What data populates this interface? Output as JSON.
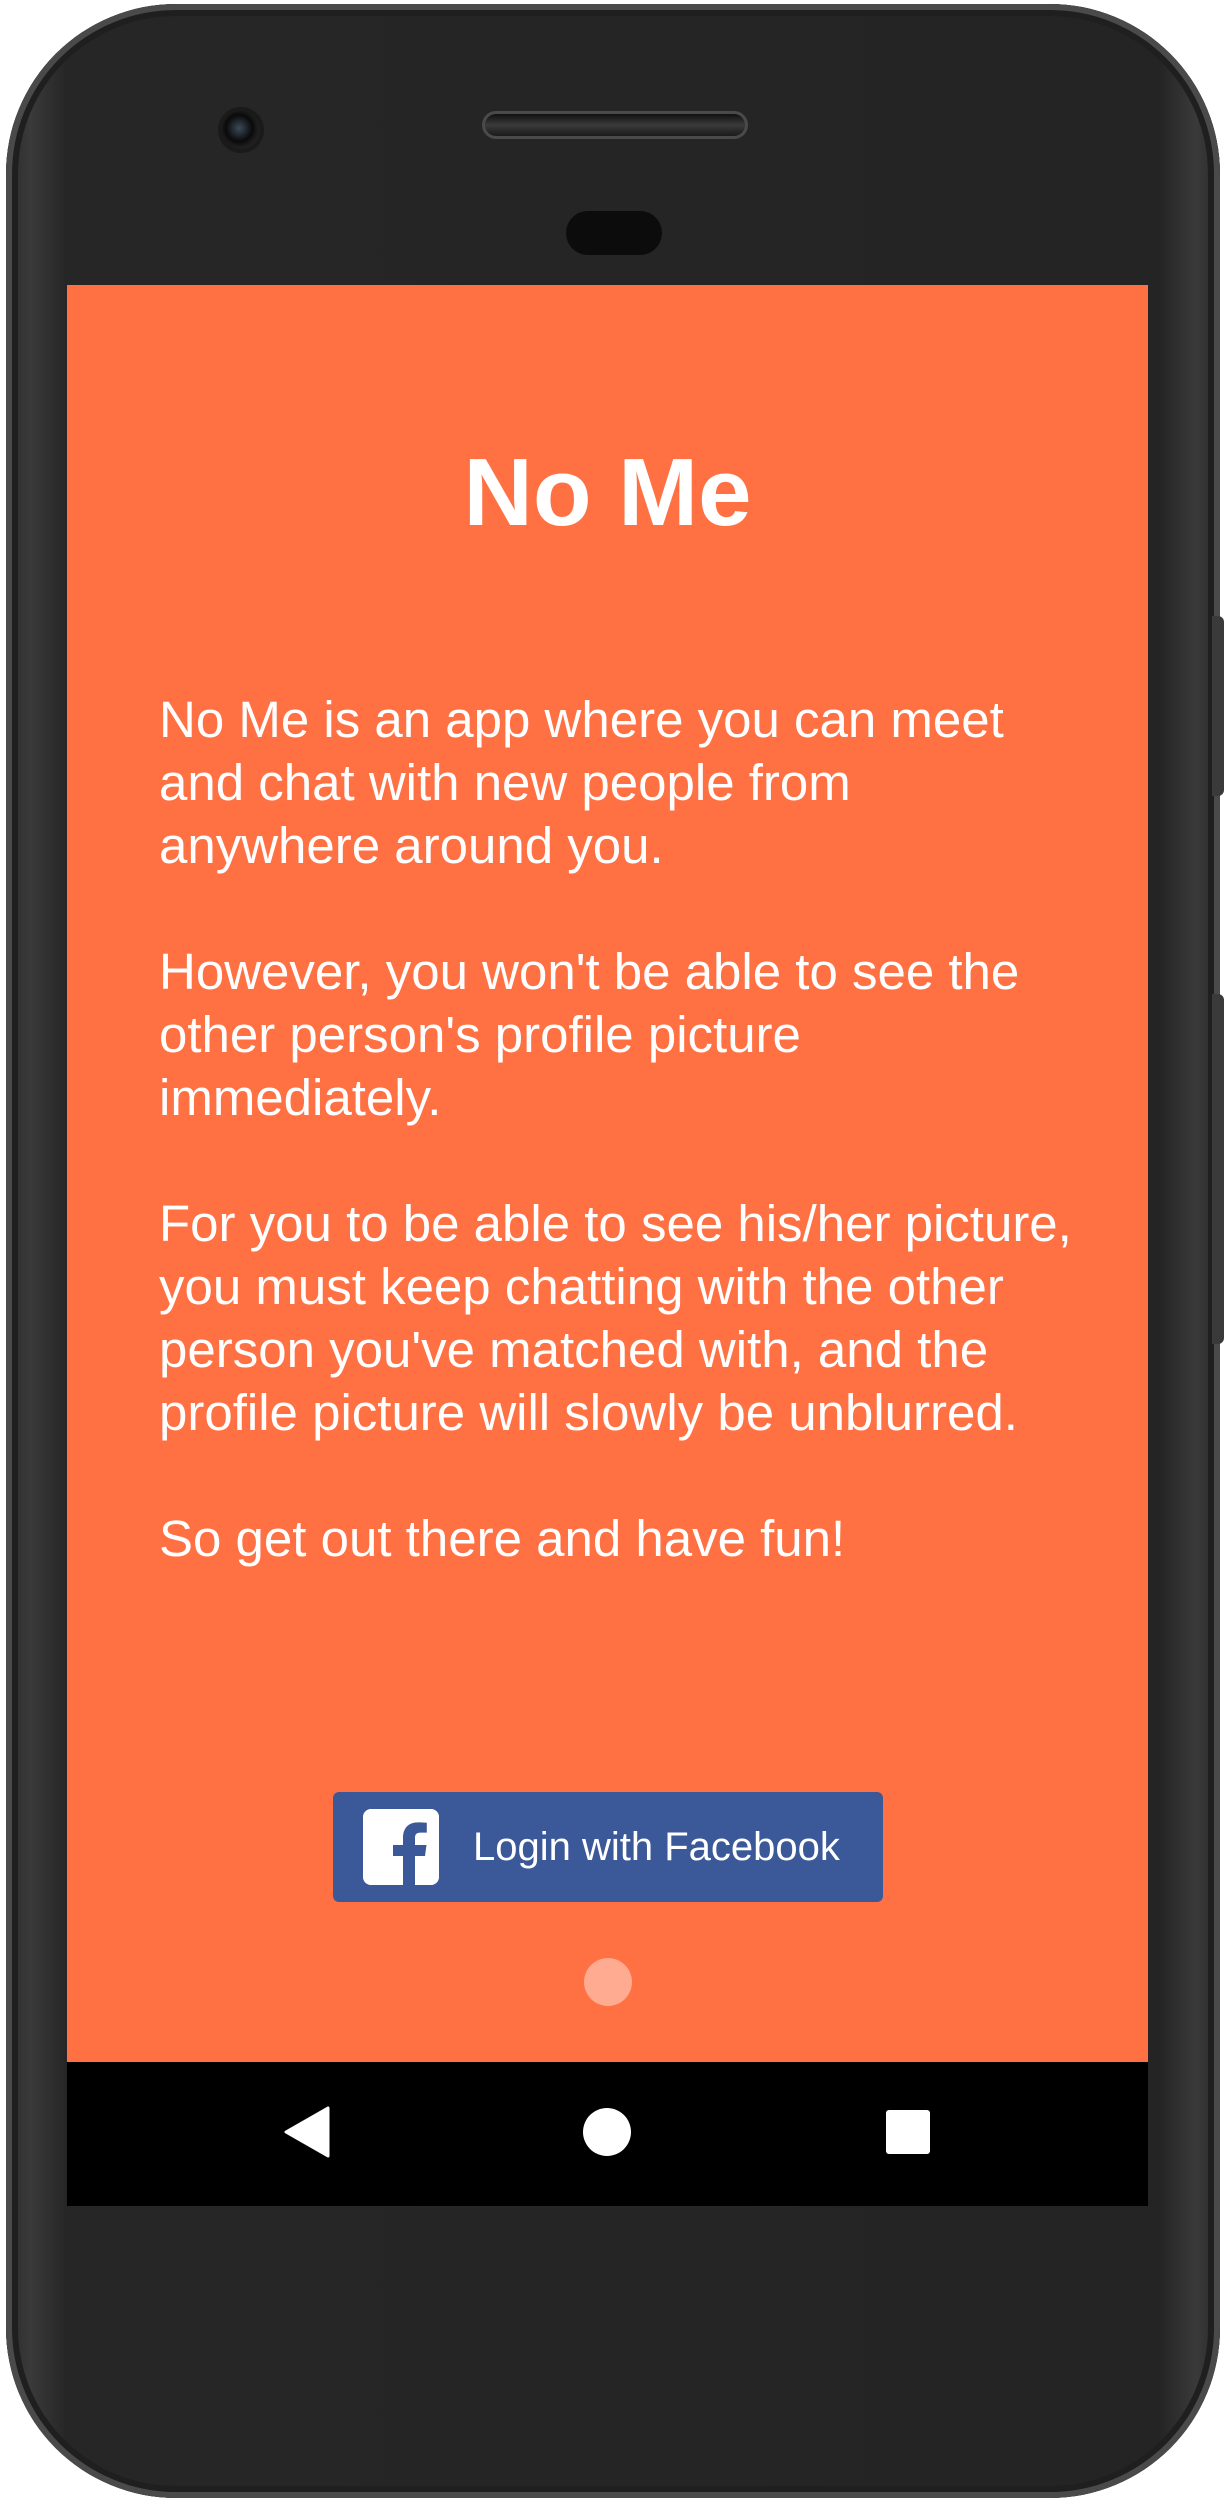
{
  "app": {
    "title": "No Me",
    "background_color": "#ff7043"
  },
  "intro": {
    "paragraphs": [
      "No Me is an app where you can meet and chat with new people from anywhere around you.",
      "However, you won't be able to see the other person's profile picture immediately.",
      "For you to be able to see his/her picture, you must keep chatting with the other person you've matched with, and the profile picture will slowly be unblurred.",
      "So get out there and have fun!"
    ]
  },
  "login": {
    "label": "Login with Facebook",
    "icon": "facebook-icon",
    "color": "#3b5998"
  },
  "pager": {
    "current_page": 1,
    "total_pages": 1,
    "dot_color": "#ffab91"
  },
  "navigation": {
    "back_icon": "back-triangle-icon",
    "home_icon": "home-circle-icon",
    "recents_icon": "recents-square-icon"
  }
}
